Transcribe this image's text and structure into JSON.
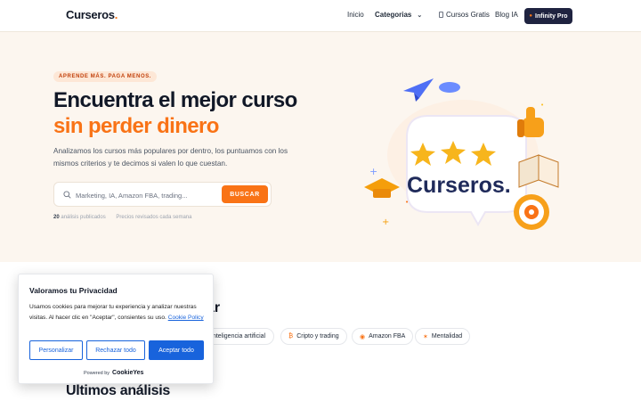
{
  "header": {
    "logo": "Curseros",
    "nav": {
      "inicio": "Inicio",
      "categorias": "Categorias",
      "cursos_gratis": "Cursos Gratis",
      "blog": "Blog IA"
    },
    "cta": "Infinity Pro"
  },
  "hero": {
    "badge": "APRENDE MÁS. PAGA MENOS.",
    "title_line1": "Encuentra el mejor curso",
    "title_line2": "sin perder dinero",
    "subtitle": "Analizamos los cursos más populares por dentro, los puntuamos con los mismos criterios y te decimos si valen lo que cuestan.",
    "search": {
      "placeholder": "Marketing, IA, Amazon FBA, trading...",
      "button": "BUSCAR"
    },
    "stats": {
      "count": "20",
      "count_label": "análisis publicados",
      "note": "Precios revisados cada semana"
    },
    "illustration_text": "Curseros."
  },
  "categories": {
    "title_partial": "ar",
    "chips": [
      {
        "label": "Inteligencia artificial",
        "icon": "ai-icon"
      },
      {
        "label": "Cripto y trading",
        "icon": "coin-icon"
      },
      {
        "label": "Amazon FBA",
        "icon": "box-icon"
      },
      {
        "label": "Mentalidad",
        "icon": "brain-icon"
      }
    ]
  },
  "latest": {
    "title": "Últimos análisis"
  },
  "cookie": {
    "title": "Valoramos tu Privacidad",
    "text": "Usamos cookies para mejorar tu experiencia y analizar nuestras visitas. Al hacer clic en \"Aceptar\", consientes su uso.",
    "link": "Cookie Policy",
    "buttons": {
      "customize": "Personalizar",
      "reject": "Rechazar todo",
      "accept": "Aceptar todo"
    },
    "powered_by": "Powered by",
    "brand": "CookieYes"
  },
  "colors": {
    "accent": "#f97316",
    "dark": "#1f2340",
    "hero_bg": "#fcf6ef",
    "cookie_blue": "#1863dc"
  }
}
